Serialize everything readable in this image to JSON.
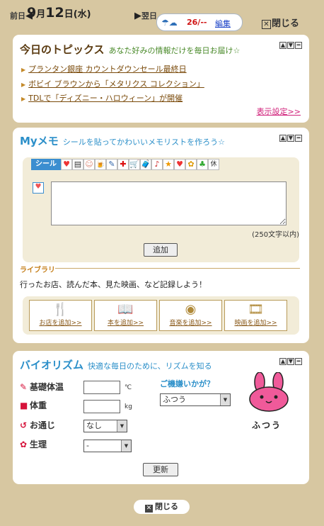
{
  "header": {
    "prev_label": "前日",
    "date_month": "9",
    "date_month_suffix": "月",
    "date_day": "12",
    "date_day_suffix": "日",
    "weekday": "(水)",
    "next_label": "翌日",
    "weather_icon": "umbrella-cloud-icon",
    "temperature": "26/--",
    "edit_label": "編集",
    "close_label": "閉じる"
  },
  "topics": {
    "title": "今日のトピックス",
    "subtitle": "あなた好みの情報だけを毎日お届け☆",
    "items": [
      {
        "text": "プランタン銀座 カウントダウンセール最終日"
      },
      {
        "text": "ボビイ ブラウンから「メタリクス コレクション」"
      },
      {
        "text": "TDLで「ディズニー・ハロウィーン」が開催"
      }
    ],
    "settings_link": "表示設定>>"
  },
  "memo": {
    "title": "Myメモ",
    "subtitle": "シールを貼ってかわいいメモリストを作ろう☆",
    "sticker_tab": "シール",
    "stickers": [
      "♥",
      "▤",
      "☺",
      "🍺",
      "✎",
      "✚",
      "🛒",
      "🧳",
      "♪",
      "★",
      "♥",
      "✿",
      "♣",
      "休"
    ],
    "textarea_value": "",
    "char_limit": "(250文字以内)",
    "add_button": "追加",
    "library_label": "ライブラリ",
    "library_text": "行ったお店、読んだ本、見た映画、など記録しよう！",
    "library_buttons": [
      {
        "icon": "fork-spoon-icon",
        "label": "お店を追加>>"
      },
      {
        "icon": "book-icon",
        "label": "本を追加>>"
      },
      {
        "icon": "cd-icon",
        "label": "音楽を追加>>"
      },
      {
        "icon": "film-icon",
        "label": "映画を追加>>"
      }
    ]
  },
  "biorhythm": {
    "title": "バイオリズム",
    "subtitle": "快適な毎日のために、リズムを知る",
    "rows": [
      {
        "label": "基礎体温",
        "unit": "℃",
        "value": ""
      },
      {
        "label": "体重",
        "unit": "kg",
        "value": ""
      },
      {
        "label": "お通じ",
        "selected": "なし"
      },
      {
        "label": "生理",
        "selected": "-"
      }
    ],
    "mood_question": "ご機嫌いかが？",
    "mood_selected": "ふつう",
    "mood_caption": "ふつう",
    "update_button": "更新"
  },
  "footer": {
    "close_label": "閉じる"
  },
  "colors": {
    "background": "#d7c7a1",
    "accent_blue": "#2b8fc9",
    "link_pink": "#d0207a",
    "link_brown": "#7a4a0a"
  }
}
